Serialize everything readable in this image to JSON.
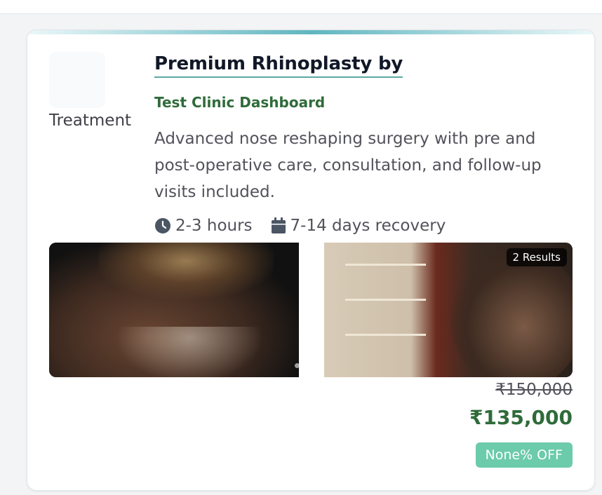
{
  "card": {
    "thumbnail_label": "Treatment",
    "title": "Premium Rhinoplasty by",
    "clinic": "Test Clinic Dashboard",
    "description": "Advanced nose reshaping surgery with pre and post-operative care, consultation, and follow-up visits included.",
    "duration": "2-3 hours",
    "recovery": "7-14 days recovery",
    "duration_icon": "clock-icon",
    "recovery_icon": "calendar-icon",
    "results_badge": "2 Results",
    "original_price": "₹150,000",
    "price": "₹135,000",
    "discount_badge": "None% OFF"
  },
  "colors": {
    "accent": "#5fb6c0",
    "clinic_green": "#2f6b3a",
    "discount_bg": "#6ccbaa"
  }
}
